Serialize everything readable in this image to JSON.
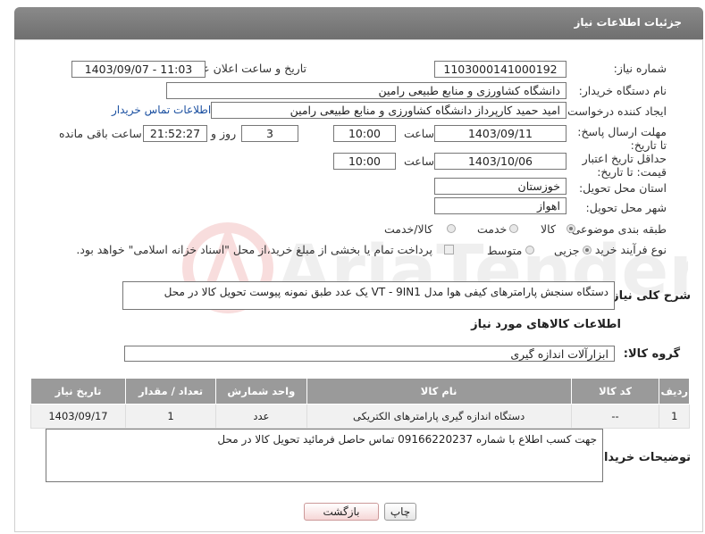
{
  "header": {
    "title": "جزئیات اطلاعات نیاز"
  },
  "fields": {
    "need_number_label": "شماره نیاز:",
    "need_number": "1103000141000192",
    "announce_label": "تاریخ و ساعت اعلان عمومی:",
    "announce_value": "1403/09/07 - 11:03",
    "buyer_org_label": "نام دستگاه خریدار:",
    "buyer_org": "دانشگاه کشاورزی و منابع طبیعی رامین",
    "creator_label": "ایجاد کننده درخواست:",
    "creator": "امید حمید کارپرداز دانشگاه کشاورزی و منابع طبیعی رامین",
    "contact_link": "اطلاعات تماس خریدار",
    "deadline_label": "مهلت ارسال پاسخ: تا تاریخ:",
    "deadline_date": "1403/09/11",
    "time_label": "ساعت",
    "deadline_time": "10:00",
    "days_value": "3",
    "days_label": "روز و",
    "remaining_time": "21:52:27",
    "remaining_label": "ساعت باقی مانده",
    "validity_label": "حداقل تاریخ اعتبار قیمت: تا تاریخ:",
    "validity_date": "1403/10/06",
    "validity_time": "10:00",
    "province_label": "استان محل تحویل:",
    "province": "خوزستان",
    "city_label": "شهر محل تحویل:",
    "city": "اهواز",
    "category_label": "طبقه بندی موضوعی:",
    "category_options": [
      "کالا",
      "خدمت",
      "کالا/خدمت"
    ],
    "process_label": "نوع فرآیند خرید :",
    "process_options": [
      "جزیی",
      "متوسط"
    ],
    "payment_note": "پرداخت تمام یا بخشی از مبلغ خرید،از محل \"اسناد خزانه اسلامی\" خواهد بود.",
    "description_label": "شرح کلی نیاز:",
    "description": "دستگاه سنجش پارامترهای کیفی هوا مدل VT - 9IN1 یک عدد طبق نمونه پیوست تحویل کالا در محل"
  },
  "goods_section": {
    "title": "اطلاعات کالاهای مورد نیاز",
    "group_label": "گروه کالا:",
    "group_value": "ابزارآلات اندازه گیری"
  },
  "table": {
    "headers": [
      "ردیف",
      "کد کالا",
      "نام کالا",
      "واحد شمارش",
      "تعداد / مقدار",
      "تاریخ نیاز"
    ],
    "rows": [
      [
        "1",
        "--",
        "دستگاه اندازه گیری پارامترهای الکتریکی",
        "عدد",
        "1",
        "1403/09/17"
      ]
    ]
  },
  "buyer_notes": {
    "label": "توضیحات خریدار:",
    "text": "جهت کسب اطلاع با شماره 09166220237 تماس حاصل فرمائید تحویل کالا در محل"
  },
  "buttons": {
    "print": "چاپ",
    "back": "بازگشت"
  },
  "watermark_text": "AriaTender.net"
}
